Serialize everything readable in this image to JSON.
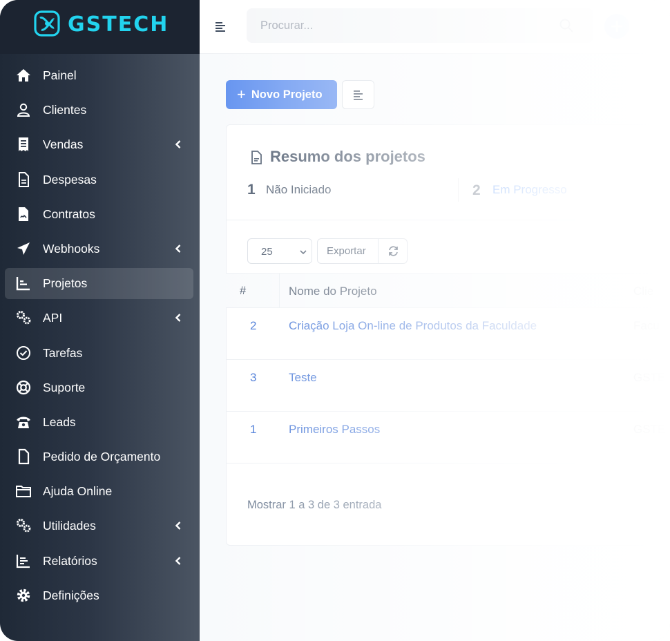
{
  "brand": {
    "name": "GSTECH",
    "accent": "#22d3ee"
  },
  "sidebar": {
    "items": [
      {
        "label": "Painel",
        "icon": "home-icon",
        "submenu": false
      },
      {
        "label": "Clientes",
        "icon": "user-icon",
        "submenu": false
      },
      {
        "label": "Vendas",
        "icon": "receipt-icon",
        "submenu": true
      },
      {
        "label": "Despesas",
        "icon": "document-icon",
        "submenu": false
      },
      {
        "label": "Contratos",
        "icon": "contract-icon",
        "submenu": false
      },
      {
        "label": "Webhooks",
        "icon": "send-icon",
        "submenu": true
      },
      {
        "label": "Projetos",
        "icon": "chart-icon",
        "submenu": false,
        "active": true
      },
      {
        "label": "API",
        "icon": "gears-icon",
        "submenu": true
      },
      {
        "label": "Tarefas",
        "icon": "check-circle-icon",
        "submenu": false
      },
      {
        "label": "Suporte",
        "icon": "lifebuoy-icon",
        "submenu": false
      },
      {
        "label": "Leads",
        "icon": "phone-icon",
        "submenu": false
      },
      {
        "label": "Pedido de Orçamento",
        "icon": "file-icon",
        "submenu": false
      },
      {
        "label": "Ajuda Online",
        "icon": "folder-icon",
        "submenu": false
      },
      {
        "label": "Utilidades",
        "icon": "gears-icon",
        "submenu": true
      },
      {
        "label": "Relatórios",
        "icon": "bar-chart-icon",
        "submenu": true
      },
      {
        "label": "Definições",
        "icon": "gear-icon",
        "submenu": false
      }
    ]
  },
  "topbar": {
    "search_placeholder": "Procurar..."
  },
  "toolbar": {
    "new_project_label": "Novo Projeto"
  },
  "summary": {
    "title": "Resumo dos projetos",
    "stats": [
      {
        "count": "1",
        "label": "Não Iniciado",
        "color": "#475569"
      },
      {
        "count": "2",
        "label": "Em Progresso",
        "color": "#3b82f6"
      }
    ]
  },
  "table": {
    "page_size": "25",
    "export_label": "Exportar",
    "columns": {
      "id": "#",
      "name": "Nome do Projeto",
      "client": "Clie"
    },
    "rows": [
      {
        "id": "2",
        "name": "Criação Loja On-line de Produtos da Faculdade",
        "client": "Facu"
      },
      {
        "id": "3",
        "name": "Teste",
        "client": "GSTE"
      },
      {
        "id": "1",
        "name": "Primeiros Passos",
        "client": "GSTE"
      }
    ],
    "info": "Mostrar 1 a 3 de 3 entrada"
  }
}
